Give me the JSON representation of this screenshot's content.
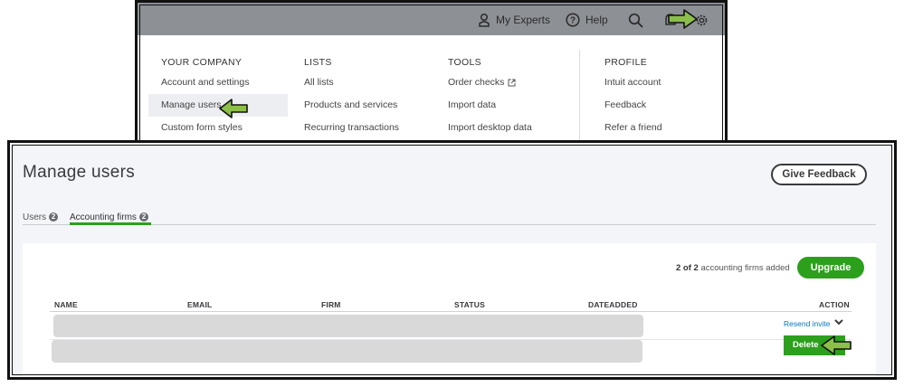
{
  "topbar": {
    "experts_label": "My Experts",
    "help_label": "Help"
  },
  "dropdown": {
    "columns": [
      {
        "heading": "YOUR COMPANY",
        "items": [
          "Account and settings",
          "Manage users",
          "Custom form styles"
        ]
      },
      {
        "heading": "LISTS",
        "items": [
          "All lists",
          "Products and services",
          "Recurring transactions"
        ]
      },
      {
        "heading": "TOOLS",
        "items": [
          "Order checks",
          "Import data",
          "Import desktop data"
        ]
      },
      {
        "heading": "PROFILE",
        "items": [
          "Intuit account",
          "Feedback",
          "Refer a friend"
        ]
      }
    ]
  },
  "page": {
    "title": "Manage users",
    "feedback_button": "Give Feedback",
    "tabs": [
      {
        "label": "Users",
        "count": "2"
      },
      {
        "label": "Accounting firms",
        "count": "2"
      }
    ],
    "firms_count_bold": "2 of 2",
    "firms_count_text": "accounting firms added",
    "upgrade_button": "Upgrade",
    "table": {
      "headers": [
        "NAME",
        "EMAIL",
        "FIRM",
        "STATUS",
        "DATEADDED",
        "ACTION"
      ],
      "row_action": "Resend invite",
      "menu_item": "Delete"
    }
  },
  "colors": {
    "accent_green": "#2ca01c",
    "link_blue": "#0077c5",
    "annotation_arrow": "#8bbf4a"
  }
}
